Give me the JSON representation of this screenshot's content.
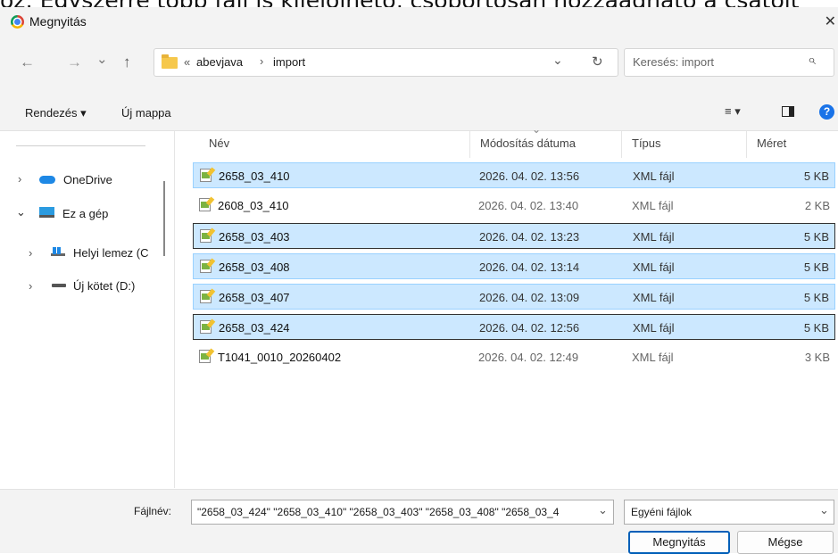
{
  "caption": "oz: Egyszerre több fájl is kijelölhető, csoportosan hozzáadható a csatolt",
  "window": {
    "title": "Megnyitás",
    "close_glyph": "✕"
  },
  "toolbar": {
    "back_glyph": "←",
    "forward_glyph": "→",
    "recent_glyph": "⌄",
    "up_glyph": "↑",
    "breadcrumb": {
      "overflow": "«",
      "parts": [
        "abevjava",
        "import"
      ],
      "sep": "›"
    },
    "refresh_glyph": "↻",
    "search_placeholder": "Keresés: import",
    "search_glyph": "⌕"
  },
  "cmdbar": {
    "organize": "Rendezés ▾",
    "new_folder": "Új mappa",
    "view_glyph": "≡ ▾",
    "help_glyph": "?"
  },
  "nav": {
    "items": [
      {
        "chevron": "›",
        "label": "OneDrive"
      },
      {
        "chevron": "⌄",
        "label": "Ez a gép"
      },
      {
        "chevron": "›",
        "label": "Helyi lemez (C"
      },
      {
        "chevron": "›",
        "label": "Új kötet (D:)"
      }
    ]
  },
  "columns": {
    "name": "Név",
    "modified": "Módosítás dátuma",
    "type": "Típus",
    "size": "Méret"
  },
  "files": [
    {
      "name": "2658_03_410",
      "modified": "2026. 04. 02. 13:56",
      "type": "XML fájl",
      "size": "5 KB",
      "selected": true
    },
    {
      "name": "2608_03_410",
      "modified": "2026. 04. 02. 13:40",
      "type": "XML fájl",
      "size": "2 KB",
      "selected": false
    },
    {
      "name": "2658_03_403",
      "modified": "2026. 04. 02. 13:23",
      "type": "XML fájl",
      "size": "5 KB",
      "selected": true
    },
    {
      "name": "2658_03_408",
      "modified": "2026. 04. 02. 13:14",
      "type": "XML fájl",
      "size": "5 KB",
      "selected": true
    },
    {
      "name": "2658_03_407",
      "modified": "2026. 04. 02. 13:09",
      "type": "XML fájl",
      "size": "5 KB",
      "selected": true
    },
    {
      "name": "2658_03_424",
      "modified": "2026. 04. 02. 12:56",
      "type": "XML fájl",
      "size": "5 KB",
      "selected": true
    },
    {
      "name": "T1041_0010_20260402",
      "modified": "2026. 04. 02. 12:49",
      "type": "XML fájl",
      "size": "3 KB",
      "selected": false
    }
  ],
  "bottom": {
    "filename_label": "Fájlnév:",
    "filename_value": "\"2658_03_424\" \"2658_03_410\" \"2658_03_403\" \"2658_03_408\" \"2658_03_4",
    "filetype_value": "Egyéni fájlok",
    "open_label": "Megnyitás",
    "cancel_label": "Mégse"
  }
}
